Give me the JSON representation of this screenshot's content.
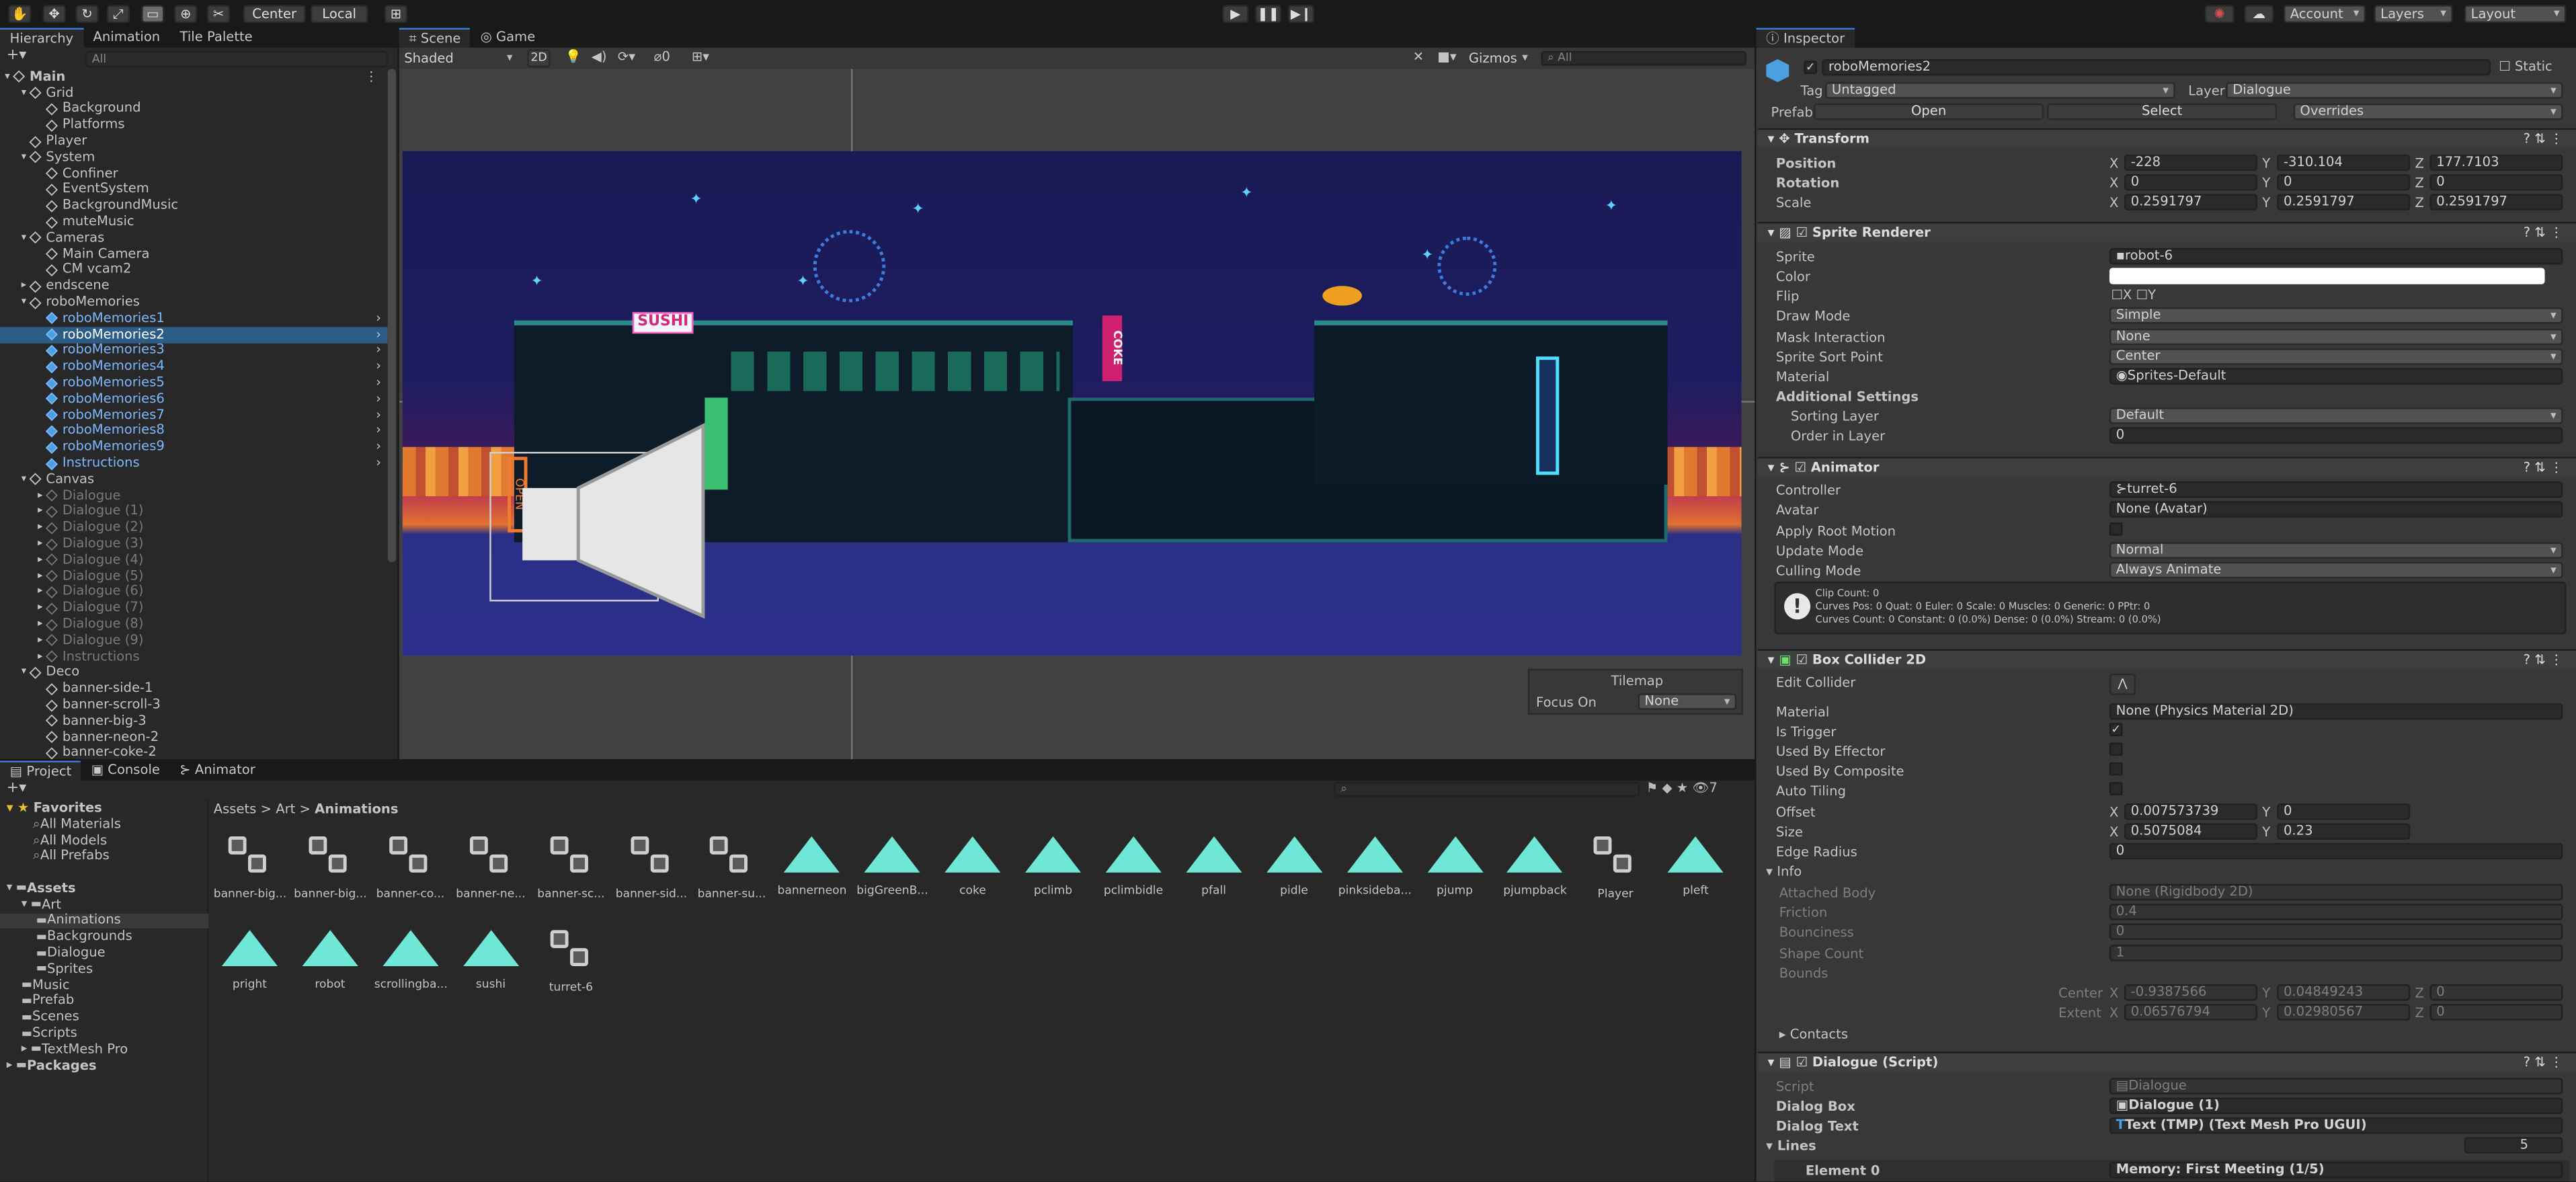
{
  "toolbar": {
    "center": "Center",
    "local": "Local",
    "account": "Account",
    "layers": "Layers",
    "layout": "Layout"
  },
  "hierarchy": {
    "tabs": [
      "Hierarchy",
      "Animation",
      "Tile Palette"
    ],
    "search_placeholder": "All",
    "items": [
      {
        "label": "Main",
        "depth": 0,
        "kind": "scene",
        "exp": "open"
      },
      {
        "label": "Grid",
        "depth": 1,
        "kind": "obj",
        "exp": "open"
      },
      {
        "label": "Background",
        "depth": 2,
        "kind": "obj",
        "exp": ""
      },
      {
        "label": "Platforms",
        "depth": 2,
        "kind": "obj",
        "exp": ""
      },
      {
        "label": "Player",
        "depth": 1,
        "kind": "obj",
        "exp": ""
      },
      {
        "label": "System",
        "depth": 1,
        "kind": "obj",
        "exp": "open"
      },
      {
        "label": "Confiner",
        "depth": 2,
        "kind": "obj",
        "exp": ""
      },
      {
        "label": "EventSystem",
        "depth": 2,
        "kind": "obj",
        "exp": ""
      },
      {
        "label": "BackgroundMusic",
        "depth": 2,
        "kind": "obj",
        "exp": ""
      },
      {
        "label": "muteMusic",
        "depth": 2,
        "kind": "obj",
        "exp": ""
      },
      {
        "label": "Cameras",
        "depth": 1,
        "kind": "obj",
        "exp": "open"
      },
      {
        "label": "Main Camera",
        "depth": 2,
        "kind": "obj",
        "exp": ""
      },
      {
        "label": "CM vcam2",
        "depth": 2,
        "kind": "obj",
        "exp": ""
      },
      {
        "label": "endscene",
        "depth": 1,
        "kind": "obj",
        "exp": "closed"
      },
      {
        "label": "roboMemories",
        "depth": 1,
        "kind": "obj",
        "exp": "open"
      },
      {
        "label": "roboMemories1",
        "depth": 2,
        "kind": "prefab",
        "exp": "",
        "arrow": true
      },
      {
        "label": "roboMemories2",
        "depth": 2,
        "kind": "prefab",
        "exp": "",
        "arrow": true,
        "selected": true
      },
      {
        "label": "roboMemories3",
        "depth": 2,
        "kind": "prefab",
        "exp": "",
        "arrow": true
      },
      {
        "label": "roboMemories4",
        "depth": 2,
        "kind": "prefab",
        "exp": "",
        "arrow": true
      },
      {
        "label": "roboMemories5",
        "depth": 2,
        "kind": "prefab",
        "exp": "",
        "arrow": true
      },
      {
        "label": "roboMemories6",
        "depth": 2,
        "kind": "prefab",
        "exp": "",
        "arrow": true
      },
      {
        "label": "roboMemories7",
        "depth": 2,
        "kind": "prefab",
        "exp": "",
        "arrow": true
      },
      {
        "label": "roboMemories8",
        "depth": 2,
        "kind": "prefab",
        "exp": "",
        "arrow": true
      },
      {
        "label": "roboMemories9",
        "depth": 2,
        "kind": "prefab",
        "exp": "",
        "arrow": true
      },
      {
        "label": "Instructions",
        "depth": 2,
        "kind": "prefab",
        "exp": "",
        "arrow": true
      },
      {
        "label": "Canvas",
        "depth": 1,
        "kind": "obj",
        "exp": "open"
      },
      {
        "label": "Dialogue",
        "depth": 2,
        "kind": "dim",
        "exp": "closed"
      },
      {
        "label": "Dialogue (1)",
        "depth": 2,
        "kind": "dim",
        "exp": "closed"
      },
      {
        "label": "Dialogue (2)",
        "depth": 2,
        "kind": "dim",
        "exp": "closed"
      },
      {
        "label": "Dialogue (3)",
        "depth": 2,
        "kind": "dim",
        "exp": "closed"
      },
      {
        "label": "Dialogue (4)",
        "depth": 2,
        "kind": "dim",
        "exp": "closed"
      },
      {
        "label": "Dialogue (5)",
        "depth": 2,
        "kind": "dim",
        "exp": "closed"
      },
      {
        "label": "Dialogue (6)",
        "depth": 2,
        "kind": "dim",
        "exp": "closed"
      },
      {
        "label": "Dialogue (7)",
        "depth": 2,
        "kind": "dim",
        "exp": "closed"
      },
      {
        "label": "Dialogue (8)",
        "depth": 2,
        "kind": "dim",
        "exp": "closed"
      },
      {
        "label": "Dialogue (9)",
        "depth": 2,
        "kind": "dim",
        "exp": "closed"
      },
      {
        "label": "Instructions",
        "depth": 2,
        "kind": "dim",
        "exp": "closed"
      },
      {
        "label": "Deco",
        "depth": 1,
        "kind": "obj",
        "exp": "open"
      },
      {
        "label": "banner-side-1",
        "depth": 2,
        "kind": "obj",
        "exp": ""
      },
      {
        "label": "banner-scroll-3",
        "depth": 2,
        "kind": "obj",
        "exp": ""
      },
      {
        "label": "banner-big-3",
        "depth": 2,
        "kind": "obj",
        "exp": ""
      },
      {
        "label": "banner-neon-2",
        "depth": 2,
        "kind": "obj",
        "exp": ""
      },
      {
        "label": "banner-coke-2",
        "depth": 2,
        "kind": "obj",
        "exp": ""
      }
    ]
  },
  "scene": {
    "tabs": [
      "Scene",
      "Game"
    ],
    "shading": "Shaded",
    "mode_2d": "2D",
    "gizmos": "Gizmos",
    "search_placeholder": "All",
    "count": "0",
    "sign_sushi": "SUSHI",
    "sign_coke": "COKE",
    "sign_open": "OPEN",
    "tilemap": {
      "title": "Tilemap",
      "focus_label": "Focus On",
      "focus_value": "None"
    }
  },
  "project": {
    "tabs": [
      "Project",
      "Console",
      "Animator"
    ],
    "count": "7",
    "favorites": {
      "title": "Favorites",
      "items": [
        "All Materials",
        "All Models",
        "All Prefabs"
      ]
    },
    "tree": [
      {
        "label": "Assets",
        "depth": 0,
        "bold": true
      },
      {
        "label": "Art",
        "depth": 1
      },
      {
        "label": "Animations",
        "depth": 2,
        "selected": true
      },
      {
        "label": "Backgrounds",
        "depth": 2
      },
      {
        "label": "Dialogue",
        "depth": 2
      },
      {
        "label": "Sprites",
        "depth": 2
      },
      {
        "label": "Music",
        "depth": 1
      },
      {
        "label": "Prefab",
        "depth": 1
      },
      {
        "label": "Scenes",
        "depth": 1
      },
      {
        "label": "Scripts",
        "depth": 1
      },
      {
        "label": "TextMesh Pro",
        "depth": 1
      },
      {
        "label": "Packages",
        "depth": 0,
        "bold": true
      }
    ],
    "breadcrumb": [
      "Assets",
      "Art",
      "Animations"
    ],
    "assets": [
      {
        "name": "banner-big...",
        "type": "controller"
      },
      {
        "name": "banner-big...",
        "type": "controller"
      },
      {
        "name": "banner-co...",
        "type": "controller"
      },
      {
        "name": "banner-ne...",
        "type": "controller"
      },
      {
        "name": "banner-sc...",
        "type": "controller"
      },
      {
        "name": "banner-sid...",
        "type": "controller"
      },
      {
        "name": "banner-su...",
        "type": "controller"
      },
      {
        "name": "bannerneon",
        "type": "clip"
      },
      {
        "name": "bigGreenB...",
        "type": "clip"
      },
      {
        "name": "coke",
        "type": "clip"
      },
      {
        "name": "pclimb",
        "type": "clip"
      },
      {
        "name": "pclimbidle",
        "type": "clip"
      },
      {
        "name": "pfall",
        "type": "clip"
      },
      {
        "name": "pidle",
        "type": "clip"
      },
      {
        "name": "pinksideba...",
        "type": "clip"
      },
      {
        "name": "pjump",
        "type": "clip"
      },
      {
        "name": "pjumpback",
        "type": "clip"
      },
      {
        "name": "Player",
        "type": "controller"
      },
      {
        "name": "pleft",
        "type": "clip"
      },
      {
        "name": "pright",
        "type": "clip"
      },
      {
        "name": "robot",
        "type": "clip"
      },
      {
        "name": "scrollingba...",
        "type": "clip"
      },
      {
        "name": "sushi",
        "type": "clip"
      },
      {
        "name": "turret-6",
        "type": "controller"
      }
    ]
  },
  "inspector": {
    "tab": "Inspector",
    "name": "roboMemories2",
    "static": "Static",
    "tag_label": "Tag",
    "tag": "Untagged",
    "layer_label": "Layer",
    "layer": "Dialogue",
    "prefab_label": "Prefab",
    "open": "Open",
    "select": "Select",
    "overrides": "Overrides",
    "transform": {
      "title": "Transform",
      "pos_label": "Position",
      "rot_label": "Rotation",
      "scale_label": "Scale",
      "pos": [
        "-228",
        "-310.104",
        "177.7103"
      ],
      "rot": [
        "0",
        "0",
        "0"
      ],
      "scale": [
        "0.2591797",
        "0.2591797",
        "0.2591797"
      ]
    },
    "sprite_renderer": {
      "title": "Sprite Renderer",
      "sprite_label": "Sprite",
      "sprite": "robot-6",
      "color_label": "Color",
      "flip_label": "Flip",
      "flip_x": "X",
      "flip_y": "Y",
      "draw_label": "Draw Mode",
      "draw": "Simple",
      "mask_label": "Mask Interaction",
      "mask": "None",
      "sort_point_label": "Sprite Sort Point",
      "sort_point": "Center",
      "material_label": "Material",
      "material": "Sprites-Default",
      "additional": "Additional Settings",
      "sorting_layer_label": "Sorting Layer",
      "sorting_layer": "Default",
      "order_label": "Order in Layer",
      "order": "0"
    },
    "animator": {
      "title": "Animator",
      "controller_label": "Controller",
      "controller": "turret-6",
      "avatar_label": "Avatar",
      "avatar": "None (Avatar)",
      "root_motion_label": "Apply Root Motion",
      "update_label": "Update Mode",
      "update": "Normal",
      "culling_label": "Culling Mode",
      "culling": "Always Animate",
      "info": [
        "Clip Count: 0",
        "Curves Pos: 0 Quat: 0 Euler: 0 Scale: 0 Muscles: 0 Generic: 0 PPtr: 0",
        "Curves Count: 0 Constant: 0 (0.0%) Dense: 0 (0.0%) Stream: 0 (0.0%)"
      ]
    },
    "box_collider": {
      "title": "Box Collider 2D",
      "edit_label": "Edit Collider",
      "material_label": "Material",
      "material": "None (Physics Material 2D)",
      "trigger_label": "Is Trigger",
      "effector_label": "Used By Effector",
      "composite_label": "Used By Composite",
      "tiling_label": "Auto Tiling",
      "offset_label": "Offset",
      "offset": [
        "0.007573739",
        "0"
      ],
      "size_label": "Size",
      "size": [
        "0.5075084",
        "0.23"
      ],
      "edge_label": "Edge Radius",
      "edge": "0",
      "info_label": "Info",
      "body_label": "Attached Body",
      "body": "None (Rigidbody 2D)",
      "friction_label": "Friction",
      "friction": "0.4",
      "bounciness_label": "Bounciness",
      "bounciness": "0",
      "shape_label": "Shape Count",
      "shape": "1",
      "bounds_label": "Bounds",
      "center_label": "Center",
      "center": [
        "-0.9387566",
        "0.04849243",
        "0"
      ],
      "extent_label": "Extent",
      "extent": [
        "0.06576794",
        "0.02980567",
        "0"
      ],
      "contacts": "Contacts"
    },
    "dialogue": {
      "title": "Dialogue (Script)",
      "script_label": "Script",
      "script": "Dialogue",
      "box_label": "Dialog Box",
      "box": "Dialogue (1)",
      "text_label": "Dialog Text",
      "text": "Text (TMP) (Text Mesh Pro UGUI)",
      "lines_label": "Lines",
      "lines": "5",
      "el0_label": "Element 0",
      "el0": "Memory: First Meeting (1/5)"
    }
  },
  "colors": {
    "accent": "#3a7cdb",
    "selected_row": "#2c5d87",
    "clip_icon": "#6fe7d6",
    "prefab_text": "#7db7ff",
    "sky": "#1c1b5e",
    "water": "#2b2f8a"
  }
}
